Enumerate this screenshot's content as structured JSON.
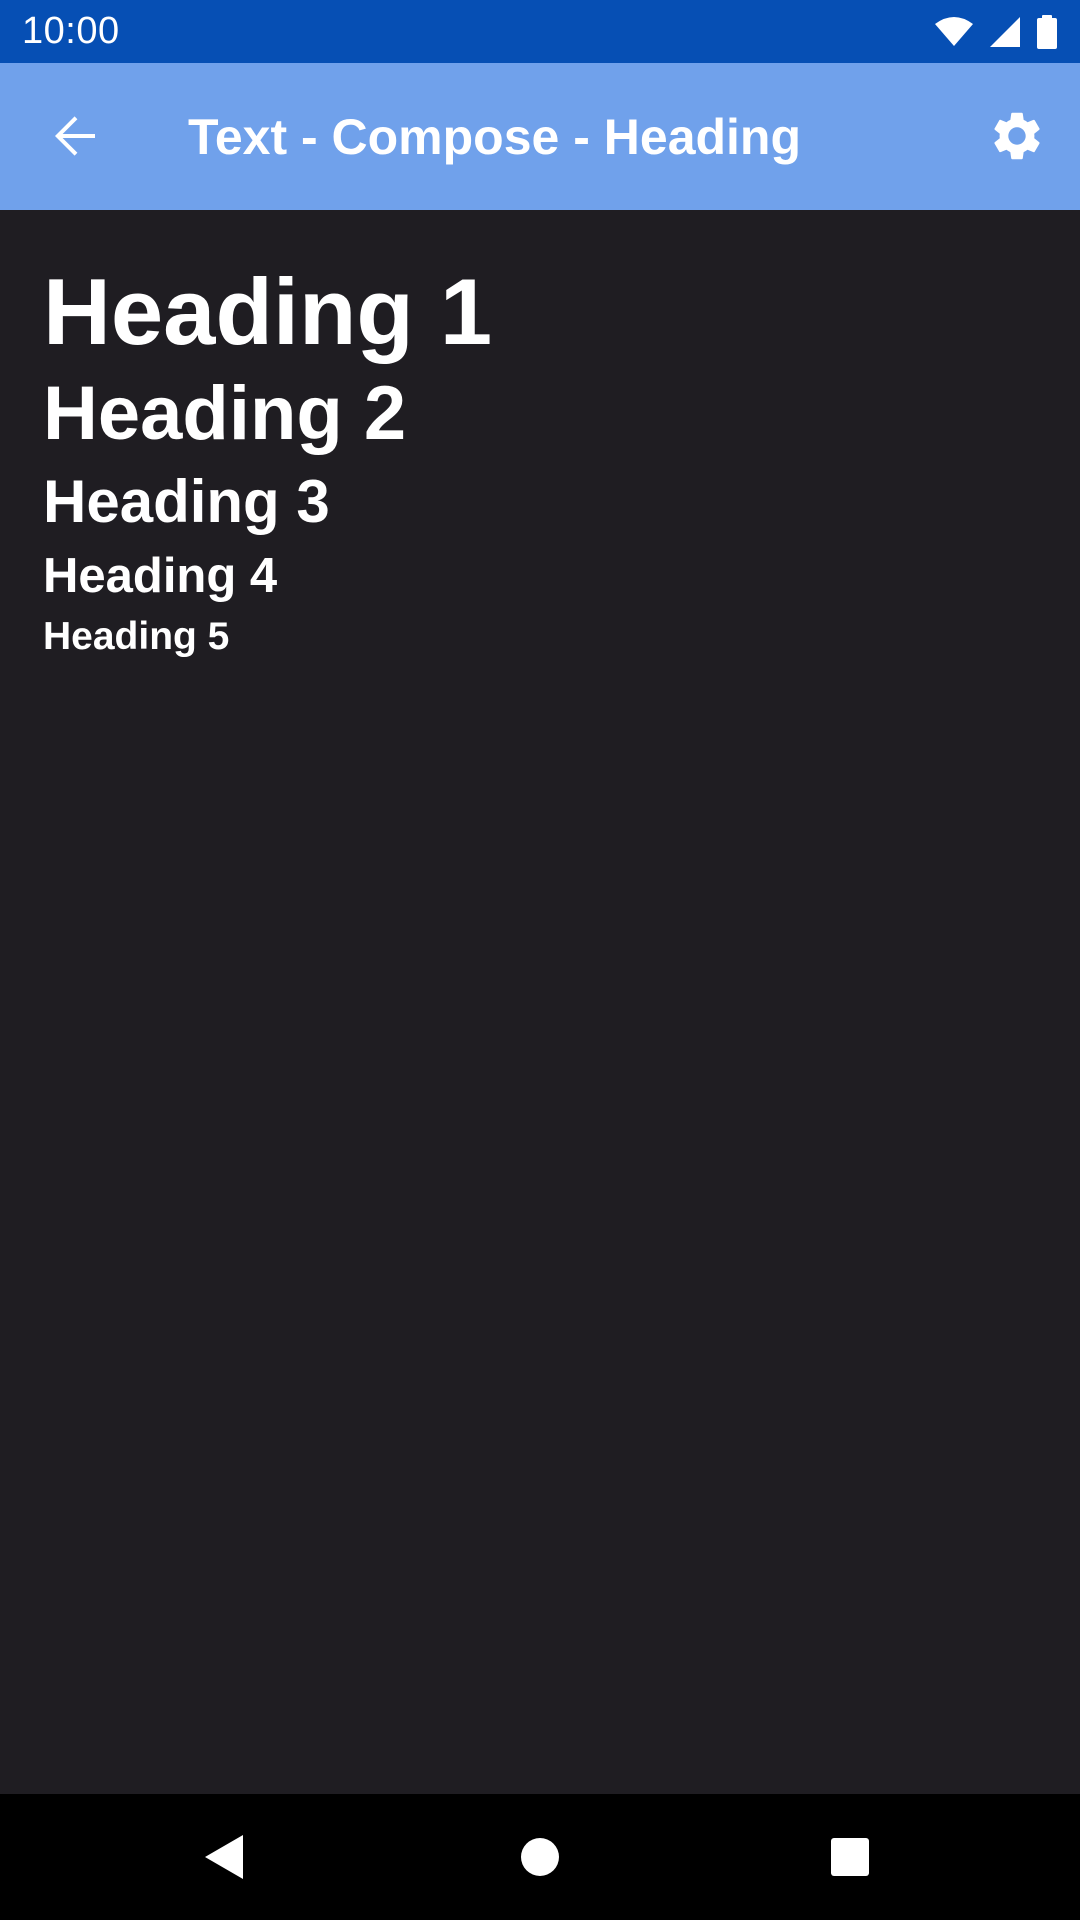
{
  "status_bar": {
    "time": "10:00",
    "icons": [
      "wifi-icon",
      "cell-signal-icon",
      "battery-icon"
    ],
    "background": "#064fb4"
  },
  "app_bar": {
    "title": "Text - Compose - Heading",
    "back_icon": "arrow-back-icon",
    "settings_icon": "gear-icon",
    "background": "#70a1eb"
  },
  "content": {
    "background": "#1f1d22",
    "headings": [
      "Heading 1",
      "Heading 2",
      "Heading 3",
      "Heading 4",
      "Heading 5"
    ]
  },
  "nav_bar": {
    "icons": [
      "nav-back-icon",
      "nav-home-icon",
      "nav-recents-icon"
    ]
  }
}
